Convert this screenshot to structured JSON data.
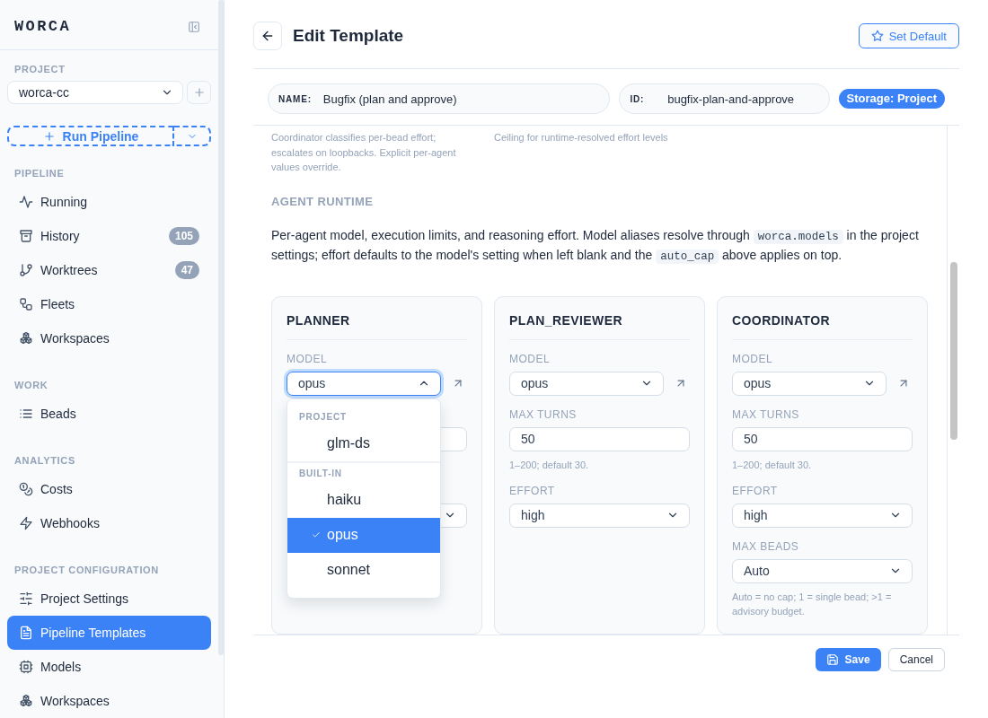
{
  "sidebar": {
    "logo": "WORCA",
    "project_label": "PROJECT",
    "project": "worca-cc",
    "run_button": "Run Pipeline",
    "sections": [
      {
        "title": "PIPELINE",
        "items": [
          {
            "label": "Running",
            "selected": false
          },
          {
            "label": "History",
            "badge": "105",
            "selected": false
          },
          {
            "label": "Worktrees",
            "badge": "47",
            "selected": false
          },
          {
            "label": "Fleets",
            "selected": false
          },
          {
            "label": "Workspaces",
            "selected": false
          }
        ]
      },
      {
        "title": "WORK",
        "items": [
          {
            "label": "Beads",
            "selected": false
          }
        ]
      },
      {
        "title": "ANALYTICS",
        "items": [
          {
            "label": "Costs",
            "selected": false
          },
          {
            "label": "Webhooks",
            "selected": false
          }
        ]
      },
      {
        "title": "PROJECT CONFIGURATION",
        "items": [
          {
            "label": "Project Settings",
            "selected": false
          },
          {
            "label": "Pipeline Templates",
            "selected": true
          },
          {
            "label": "Models",
            "selected": false
          },
          {
            "label": "Workspaces",
            "selected": false
          }
        ]
      }
    ]
  },
  "header": {
    "title": "Edit Template",
    "set_default_button": "Set Default"
  },
  "template": {
    "name_label": "NAME:",
    "name": "Bugfix (plan and approve)",
    "id_label": "ID:",
    "id": "bugfix-plan-and-approve",
    "storage": "Storage: Project"
  },
  "content": {
    "hints": [
      "Coordinator classifies per-bead effort; escalates on loopbacks. Explicit per-agent values override.",
      "Ceiling for runtime-resolved effort levels"
    ],
    "section_title": "AGENT RUNTIME",
    "description": [
      {
        "kind": "text",
        "text": "Per-agent model, execution limits, and reasoning effort. Model aliases resolve through "
      },
      {
        "kind": "code",
        "text": "worca.models"
      },
      {
        "kind": "text",
        "text": " in the project settings; effort defaults to the model's setting when left blank and the "
      },
      {
        "kind": "code",
        "text": "auto_cap"
      },
      {
        "kind": "text",
        "text": " above applies on top."
      }
    ],
    "agents": [
      {
        "name": "PLANNER",
        "fields": [
          {
            "kind": "model",
            "label": "MODEL",
            "value": "opus",
            "expanded": true,
            "menu": {
              "groups": [
                {
                  "label": "PROJECT",
                  "options": [
                    {
                      "label": "glm-ds",
                      "selected": false
                    }
                  ]
                },
                {
                  "label": "BUILT-IN",
                  "options": [
                    {
                      "label": "haiku",
                      "selected": false
                    },
                    {
                      "label": "opus",
                      "selected": true
                    },
                    {
                      "label": "sonnet",
                      "selected": false
                    }
                  ]
                }
              ]
            }
          },
          {
            "kind": "text"
          },
          {
            "kind": "select"
          }
        ]
      },
      {
        "name": "PLAN_REVIEWER",
        "fields": [
          {
            "kind": "model",
            "label": "MODEL",
            "value": "opus",
            "expanded": false
          },
          {
            "kind": "text",
            "label": "MAX TURNS",
            "value": "50",
            "hint": "1–200; default 30."
          },
          {
            "kind": "select",
            "label": "EFFORT",
            "value": "high"
          }
        ]
      },
      {
        "name": "COORDINATOR",
        "fields": [
          {
            "kind": "model",
            "label": "MODEL",
            "value": "opus",
            "expanded": false
          },
          {
            "kind": "text",
            "label": "MAX TURNS",
            "value": "50",
            "hint": "1–200; default 30."
          },
          {
            "kind": "select",
            "label": "EFFORT",
            "value": "high"
          },
          {
            "kind": "select",
            "label": "MAX BEADS",
            "value": "Auto",
            "hint": "Auto = no cap; 1 = single bead; >1 = advisory budget."
          }
        ]
      }
    ]
  },
  "footer": {
    "save_button": "Save",
    "cancel_button": "Cancel"
  }
}
